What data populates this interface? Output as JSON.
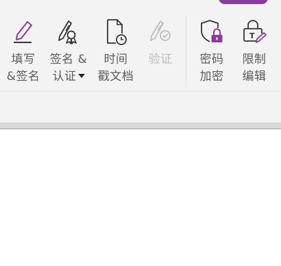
{
  "ribbon": {
    "accent_color": "#8b3a9e",
    "groups": [
      {
        "id": "fill-sign",
        "line1": "填写",
        "line2": "&签名",
        "icon": "pen-underline-icon",
        "enabled": true
      },
      {
        "id": "sign-certify",
        "line1": "签名 &",
        "line2": "认证",
        "icon": "pen-ribbon-icon",
        "enabled": true,
        "has_dropdown": true
      },
      {
        "id": "timestamp",
        "line1": "时间",
        "line2": "戳文档",
        "icon": "document-clock-icon",
        "enabled": true
      },
      {
        "id": "verify",
        "line1": "验证",
        "line2": "",
        "icon": "pen-check-icon",
        "enabled": false
      },
      {
        "id": "encrypt",
        "line1": "密码",
        "line2": "加密",
        "icon": "shield-lock-icon",
        "enabled": true
      },
      {
        "id": "restrict-edit",
        "line1": "限制",
        "line2": "编辑",
        "icon": "lock-edit-icon",
        "enabled": true
      }
    ]
  }
}
